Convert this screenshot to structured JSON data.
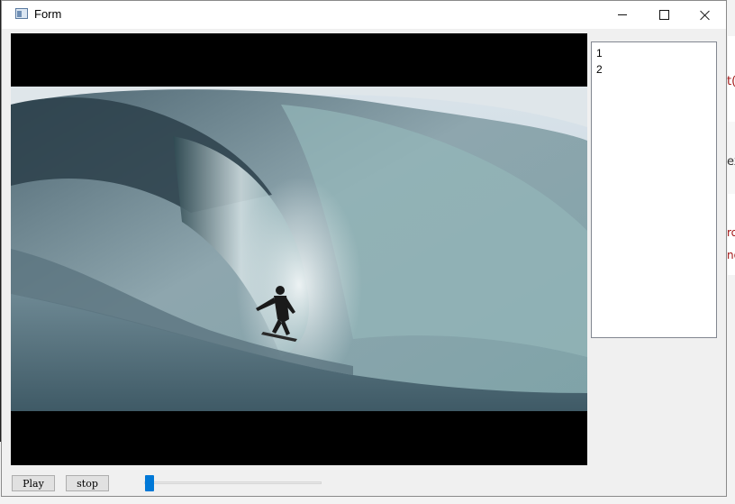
{
  "window": {
    "title": "Form"
  },
  "video": {
    "description_icon": "video-frame"
  },
  "playlist": {
    "items": [
      "1",
      "2"
    ]
  },
  "controls": {
    "play_label": "Play",
    "stop_label": "stop",
    "seek_position": 0
  },
  "background": {
    "glyph_left": "m",
    "glyph_right_1": "t(",
    "glyph_right_2": "ex",
    "glyph_right_3": "ro",
    "glyph_right_4": "no"
  },
  "colors": {
    "accent": "#0078d7",
    "title_bar": "#ffffff",
    "window_bg": "#f0f0f0"
  }
}
